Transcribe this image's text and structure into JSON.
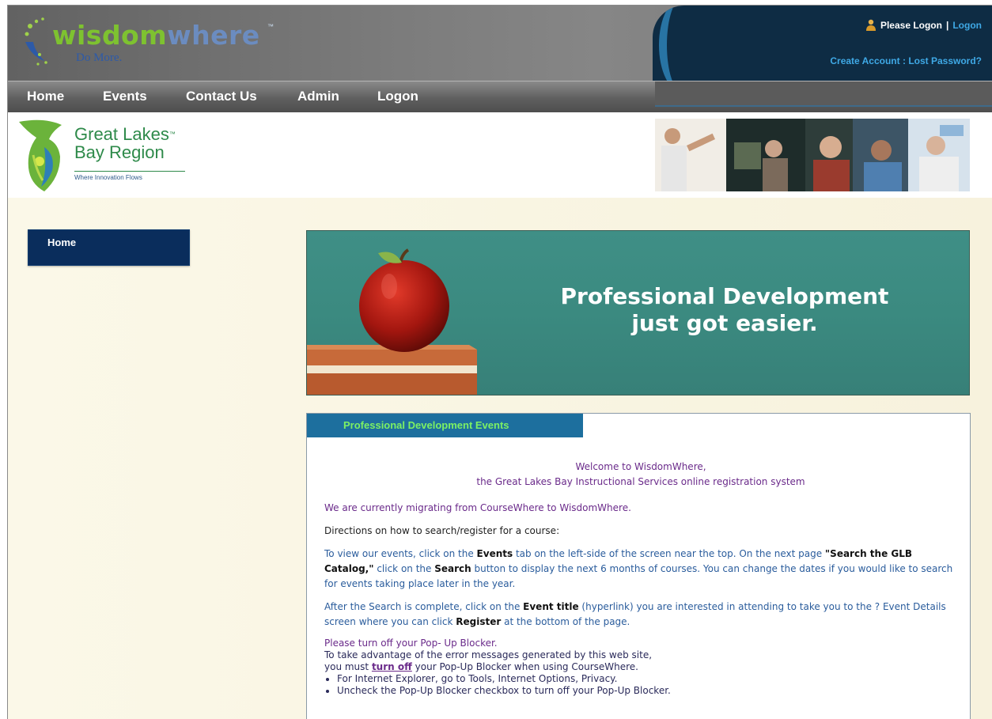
{
  "header": {
    "brand_word_1": "wisdom",
    "brand_word_2": "where",
    "brand_tm": "™",
    "brand_tagline": "Do More.",
    "please_logon": "Please Logon",
    "separator": "|",
    "logon_link": "Logon",
    "create_account": "Create Account",
    "account_sep": ":",
    "lost_password": "Lost Password?"
  },
  "nav": {
    "items": [
      {
        "label": "Home"
      },
      {
        "label": "Events"
      },
      {
        "label": "Contact Us"
      },
      {
        "label": "Admin"
      },
      {
        "label": "Logon"
      }
    ]
  },
  "region_logo": {
    "line1": "Great Lakes",
    "line2": "Bay Region",
    "tagline": "Where Innovation Flows",
    "tm": "™"
  },
  "sidebar": {
    "home_label": "Home"
  },
  "hero": {
    "line1": "Professional Development",
    "line2": "just got easier."
  },
  "panel": {
    "tab_label": "Professional Development Events",
    "welcome_line1": "Welcome to WisdomWhere,",
    "welcome_line2": "the Great Lakes Bay Instructional Services online registration system",
    "migrating": "We are currently migrating from CourseWhere to WisdomWhere.",
    "directions": "Directions on how to search/register for a course:",
    "p1_a": "To view our events, click on the ",
    "p1_events": "Events",
    "p1_b": " tab on the left-side of the screen near the top. On the next page ",
    "p1_search_catalog": "\"Search the GLB Catalog,\"",
    "p1_c": " click on the ",
    "p1_search": "Search",
    "p1_d": " button to display the next 6 months of courses. You can change the dates if you would like to search for events taking place later in the year.",
    "p2_a": "After the Search is complete, click on the ",
    "p2_event_title": "Event title",
    "p2_b": " (hyperlink) you are interested in attending to take you to the ? Event Details screen where you can click ",
    "p2_register": "Register",
    "p2_c": " at the bottom of the page.",
    "popup_heading": "Please turn off your Pop- Up Blocker.",
    "popup_line1": "To take advantage of the error messages generated by this web site,",
    "popup_line2_a": "you must ",
    "popup_turn_off": "turn off",
    "popup_line2_b": " your Pop-Up Blocker when using CourseWhere.",
    "bullets": [
      "For Internet Explorer, go to Tools, Internet Options, Privacy.",
      "Uncheck the Pop-Up Blocker checkbox to turn off your Pop-Up Blocker."
    ]
  },
  "colors": {
    "nav_bg": "#5f5f5f",
    "header_dark": "#0e2c44",
    "link_blue": "#3fa9e6",
    "sidebar_home_bg": "#0a2d5c",
    "hero_teal": "#3b8a80",
    "panel_tab_bg": "#1d6f9e",
    "panel_tab_text": "#7cf064",
    "welcome_purple": "#6a2a8a",
    "body_text_blue": "#2a5c9c"
  },
  "icons": {
    "user": "user-icon",
    "brand": "wisdomwhere-logo",
    "region": "michigan-leaf-logo",
    "apple": "apple-on-books-illustration"
  }
}
